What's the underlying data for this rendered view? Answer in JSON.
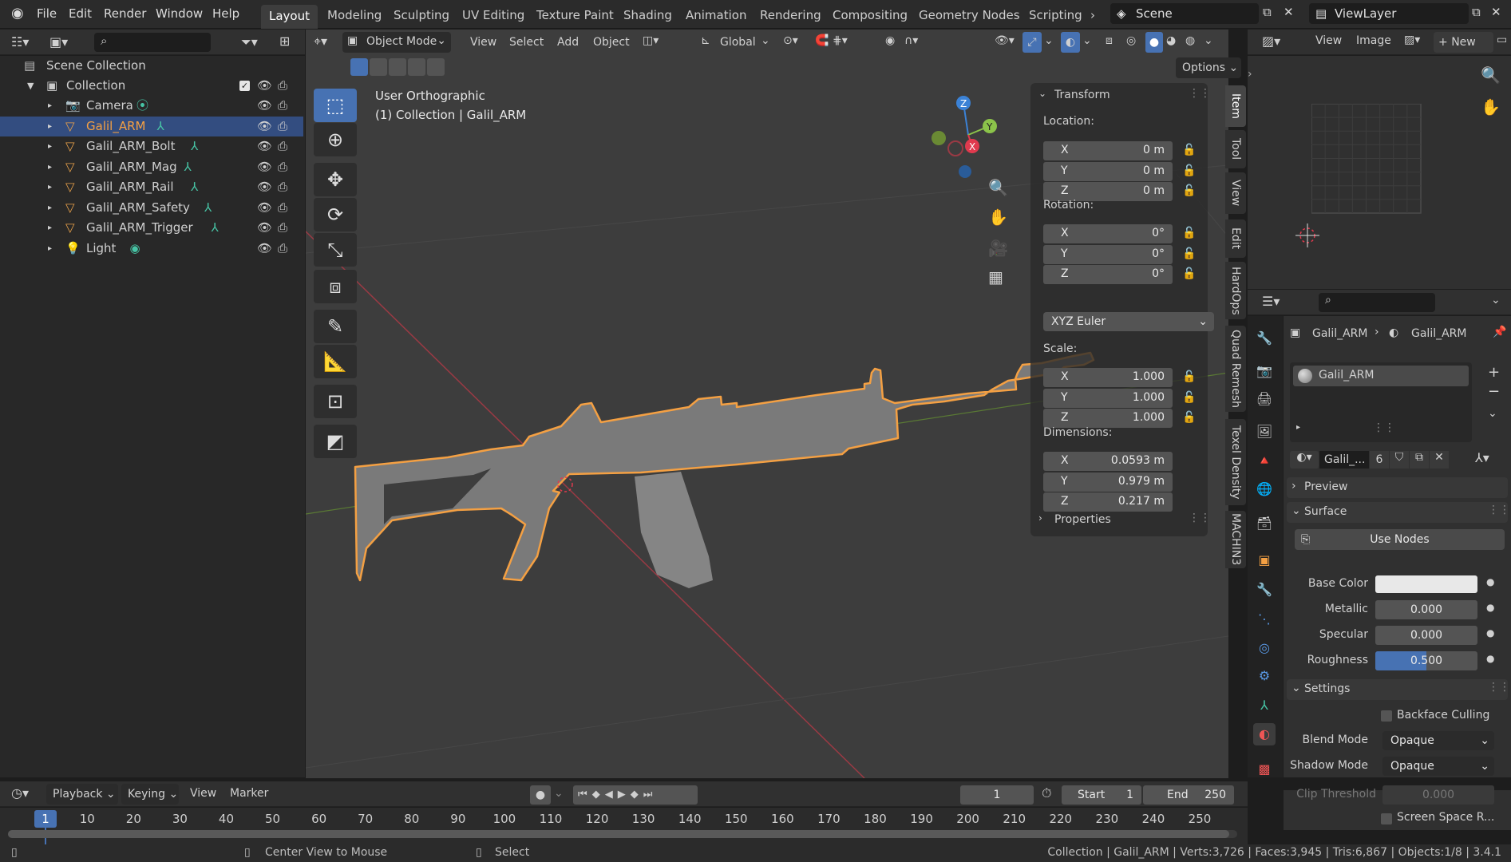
{
  "menu": {
    "file": "File",
    "edit": "Edit",
    "render": "Render",
    "window": "Window",
    "help": "Help"
  },
  "workspaces": [
    "Layout",
    "Modeling",
    "Sculpting",
    "UV Editing",
    "Texture Paint",
    "Shading",
    "Animation",
    "Rendering",
    "Compositing",
    "Geometry Nodes",
    "Scripting"
  ],
  "scene": {
    "name": "Scene",
    "view_layer": "ViewLayer"
  },
  "outliner": {
    "root": "Scene Collection",
    "collection": "Collection",
    "items": [
      {
        "name": "Camera",
        "type": "camera"
      },
      {
        "name": "Galil_ARM",
        "type": "mesh",
        "selected": true
      },
      {
        "name": "Galil_ARM_Bolt",
        "type": "mesh"
      },
      {
        "name": "Galil_ARM_Mag",
        "type": "mesh"
      },
      {
        "name": "Galil_ARM_Rail",
        "type": "mesh"
      },
      {
        "name": "Galil_ARM_Safety",
        "type": "mesh"
      },
      {
        "name": "Galil_ARM_Trigger",
        "type": "mesh"
      },
      {
        "name": "Light",
        "type": "light"
      }
    ]
  },
  "viewport": {
    "mode": "Object Mode",
    "view": "View",
    "select": "Select",
    "add": "Add",
    "object": "Object",
    "orientation": "Global",
    "options": "Options",
    "title": "User Orthographic",
    "subtitle": "(1) Collection | Galil_ARM",
    "gizmo": {
      "z": "Z",
      "y": "Y",
      "x": "X"
    }
  },
  "transform": {
    "header": "Transform",
    "location_label": "Location:",
    "location": [
      {
        "axis": "X",
        "value": "0 m"
      },
      {
        "axis": "Y",
        "value": "0 m"
      },
      {
        "axis": "Z",
        "value": "0 m"
      }
    ],
    "rotation_label": "Rotation:",
    "rotation": [
      {
        "axis": "X",
        "value": "0°"
      },
      {
        "axis": "Y",
        "value": "0°"
      },
      {
        "axis": "Z",
        "value": "0°"
      }
    ],
    "rotation_mode": "XYZ Euler",
    "scale_label": "Scale:",
    "scale": [
      {
        "axis": "X",
        "value": "1.000"
      },
      {
        "axis": "Y",
        "value": "1.000"
      },
      {
        "axis": "Z",
        "value": "1.000"
      }
    ],
    "dimensions_label": "Dimensions:",
    "dimensions": [
      {
        "axis": "X",
        "value": "0.0593 m"
      },
      {
        "axis": "Y",
        "value": "0.979 m"
      },
      {
        "axis": "Z",
        "value": "0.217 m"
      }
    ],
    "properties": "Properties"
  },
  "sidebar_tabs": [
    "Item",
    "Tool",
    "View",
    "Edit",
    "HardOps",
    "Quad Remesh",
    "Texel Density",
    "MACHIN3"
  ],
  "image_editor": {
    "view": "View",
    "image": "Image",
    "new": "New"
  },
  "properties": {
    "breadcrumb_object": "Galil_ARM",
    "breadcrumb_material": "Galil_ARM",
    "slot": "Galil_ARM",
    "material_name": "Galil_...",
    "users": "6",
    "preview": "Preview",
    "surface": "Surface",
    "use_nodes": "Use Nodes",
    "base_color_label": "Base Color",
    "base_color": "#e8e8e8",
    "metallic_label": "Metallic",
    "metallic": "0.000",
    "specular_label": "Specular",
    "specular": "0.000",
    "roughness_label": "Roughness",
    "roughness": "0.500",
    "roughness_fraction": 0.5,
    "settings": "Settings",
    "backface": "Backface Culling",
    "blend_label": "Blend Mode",
    "blend": "Opaque",
    "shadow_label": "Shadow Mode",
    "shadow": "Opaque",
    "clip_label": "Clip Threshold",
    "clip": "0.000",
    "ssr": "Screen Space R..."
  },
  "timeline": {
    "playback": "Playback",
    "keying": "Keying",
    "view": "View",
    "marker": "Marker",
    "current_frame": "1",
    "start_label": "Start",
    "start": "1",
    "end_label": "End",
    "end": "250",
    "ticks": [
      "1",
      "10",
      "20",
      "30",
      "40",
      "50",
      "60",
      "70",
      "80",
      "90",
      "100",
      "110",
      "120",
      "130",
      "140",
      "150",
      "160",
      "170",
      "180",
      "190",
      "200",
      "210",
      "220",
      "230",
      "240",
      "250"
    ]
  },
  "statusbar": {
    "center_view": "Center View to Mouse",
    "select": "Select",
    "stats": "Collection | Galil_ARM | Verts:3,726 | Faces:3,945 | Tris:6,867 | Objects:1/8 | 3.4.1"
  },
  "colors": {
    "accent": "#4772b3",
    "selection_outline": "#f4a043",
    "x_axis": "#e03a4e",
    "y_axis": "#8bc34a",
    "z_axis": "#3b82d6"
  }
}
